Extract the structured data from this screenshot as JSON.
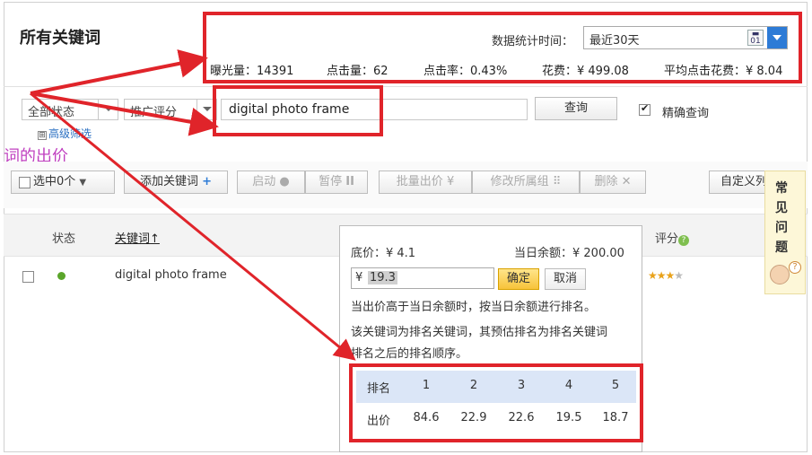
{
  "page": {
    "title": "所有关键词"
  },
  "stats": {
    "period_label": "数据统计时间：",
    "period_value": "最近30天",
    "calendar_glyph": "01",
    "impressions": "曝光量：14391",
    "clicks": "点击量：62",
    "ctr": "点击率：0.43%",
    "cost": "花费：¥ 499.08",
    "avg_cpc": "平均点击花费：¥ 8.04"
  },
  "filters": {
    "status_select": "全部状态",
    "score_select": "推广评分",
    "search_value": "digital photo frame",
    "search_button": "查询",
    "exact_label": "精确查询",
    "exact_checked": true,
    "advanced_filter": "高级筛选",
    "advanced_plus": "⊞"
  },
  "side_text": "词的出价",
  "actions": {
    "selected": "选中0个",
    "add_keyword": "添加关键词",
    "add_plus": "+",
    "start": "启动",
    "start_glyph": "●",
    "pause": "暂停",
    "pause_glyph": "II",
    "batch_bid": "批量出价",
    "batch_glyph": "¥",
    "change_group": "修改所属组",
    "group_glyph": "⠿",
    "delete": "删除",
    "delete_glyph": "✕",
    "customize": "自定义列"
  },
  "table": {
    "col_status": "状态",
    "col_keyword": "关键词",
    "keyword_sort": "↑",
    "col_score": "评分",
    "score_help": "?",
    "row": {
      "keyword": "digital photo frame",
      "status": "active",
      "stars_on": "★★★",
      "stars_off": "★"
    }
  },
  "popup": {
    "base_price": "底价：¥ 4.1",
    "daily_balance": "当日余额：¥ 200.00",
    "currency": "¥",
    "bid_value": "19.3",
    "ok": "确定",
    "cancel": "取消",
    "note1": "当出价高于当日余额时，按当日余额进行排名。",
    "note2": "该关键词为排名关键词，其预估排名为排名关键词",
    "note3": "排名之后的排名顺序。",
    "rank_label": "排名",
    "bid_label": "出价",
    "ranks": [
      "1",
      "2",
      "3",
      "4",
      "5"
    ],
    "bids": [
      "84.6",
      "22.9",
      "22.6",
      "19.5",
      "18.7"
    ]
  },
  "faq": {
    "label": "常见问题",
    "q": "?"
  },
  "colors": {
    "annotation": "#e0242a",
    "accent": "#2d7bd6",
    "status_active": "#5aa52a",
    "side_text": "#c040c0"
  }
}
